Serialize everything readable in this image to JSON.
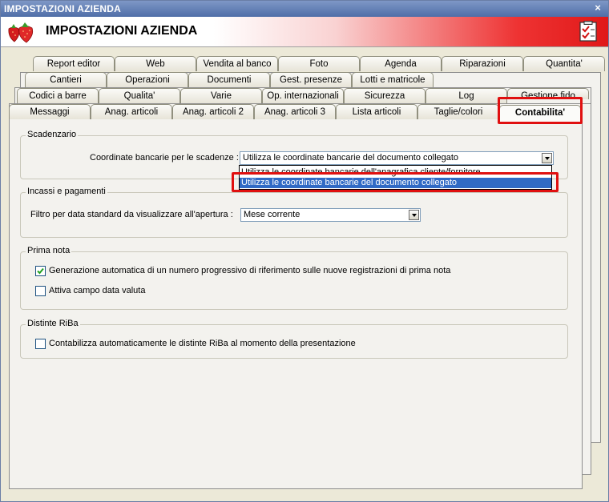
{
  "window": {
    "title": "IMPOSTAZIONI AZIENDA",
    "close_glyph": "×"
  },
  "header": {
    "title": "IMPOSTAZIONI AZIENDA",
    "logo_icon": "strawberries-icon",
    "action_icon": "checklist-icon"
  },
  "tabs": {
    "row1": [
      "Report editor",
      "Web",
      "Vendita al banco",
      "Foto",
      "Agenda",
      "Riparazioni",
      "Quantita'"
    ],
    "row2": [
      "Cantieri",
      "Operazioni",
      "Documenti",
      "Gest. presenze",
      "Lotti e matricole"
    ],
    "row3": [
      "Codici a barre",
      "Qualita'",
      "Varie",
      "Op. internazionali",
      "Sicurezza",
      "Log",
      "Gestione fido"
    ],
    "row4": [
      "Messaggi",
      "Anag. articoli",
      "Anag. articoli 2",
      "Anag. articoli 3",
      "Lista articoli",
      "Taglie/colori",
      "Contabilita'"
    ],
    "active": "Contabilita'"
  },
  "scadenzario": {
    "title": "Scadenzario",
    "label": "Coordinate bancarie per le scadenze :",
    "value": "Utilizza le coordinate bancarie del documento collegato",
    "options": [
      "Utilizza le coordinate bancarie dell'anagrafica cliente/fornitore",
      "Utilizza le coordinate bancarie del documento collegato"
    ],
    "selected_index": 1
  },
  "incassi": {
    "title": "Incassi e pagamenti",
    "label": "Filtro per data standard da visualizzare all'apertura :",
    "value": "Mese corrente"
  },
  "prima_nota": {
    "title": "Prima nota",
    "items": [
      {
        "label": "Generazione automatica di un numero progressivo di riferimento sulle nuove registrazioni di prima nota",
        "checked": true
      },
      {
        "label": "Attiva campo data valuta",
        "checked": false
      }
    ]
  },
  "distinte": {
    "title": "Distinte RiBa",
    "items": [
      {
        "label": "Contabilizza automaticamente le distinte RiBa al momento della presentazione",
        "checked": false
      }
    ]
  },
  "colors": {
    "highlight": "#e01010",
    "selection": "#316ac5",
    "titlebar": "#5f7bb3"
  }
}
